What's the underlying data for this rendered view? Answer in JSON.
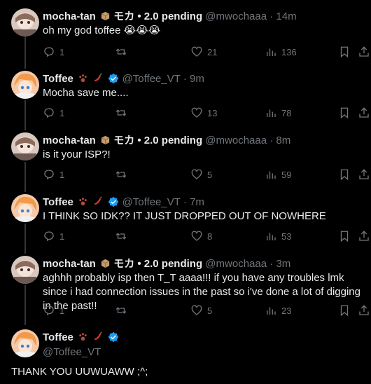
{
  "thread": [
    {
      "name": "mocha-tan",
      "emoji_suffix": "モカ • 2.0 pending",
      "handle": "@mwochaaa",
      "time": "14m",
      "text": "oh my god toffee 😭😭😭",
      "replies": "1",
      "likes": "21",
      "views": "136",
      "avatar": "mocha-avatar"
    },
    {
      "name": "Toffee",
      "handle": "@Toffee_VT",
      "time": "9m",
      "text": "Mocha save me....",
      "replies": "1",
      "likes": "13",
      "views": "78",
      "verified": true,
      "avatar": "toffee-avatar"
    },
    {
      "name": "mocha-tan",
      "emoji_suffix": "モカ • 2.0 pending",
      "handle": "@mwochaaa",
      "time": "8m",
      "text": "is it your ISP?!",
      "replies": "1",
      "likes": "5",
      "views": "59",
      "avatar": "mocha-avatar"
    },
    {
      "name": "Toffee",
      "handle": "@Toffee_VT",
      "time": "7m",
      "text": "I THINK SO IDK?? IT JUST DROPPED OUT OF NOWHERE",
      "replies": "1",
      "likes": "8",
      "views": "53",
      "verified": true,
      "avatar": "toffee-avatar"
    },
    {
      "name": "mocha-tan",
      "emoji_suffix": "モカ • 2.0 pending",
      "handle": "@mwochaaa",
      "time": "3m",
      "text": "aghhh probably isp then T_T aaaa!!! if you have any troubles lmk since i had connection issues in the past so i've done a lot of digging in the past!!",
      "replies": "1",
      "likes": "5",
      "views": "23",
      "avatar": "mocha-avatar"
    }
  ],
  "main_tweet": {
    "name": "Toffee",
    "handle": "@Toffee_VT",
    "text": "THANK YOU UUWUAWW ;^;",
    "verified": true
  },
  "separator": "·",
  "colors": {
    "bg": "#000000",
    "text": "#e7e9ea",
    "muted": "#71767b",
    "verified": "#1d9bf0",
    "line": "#333639"
  }
}
